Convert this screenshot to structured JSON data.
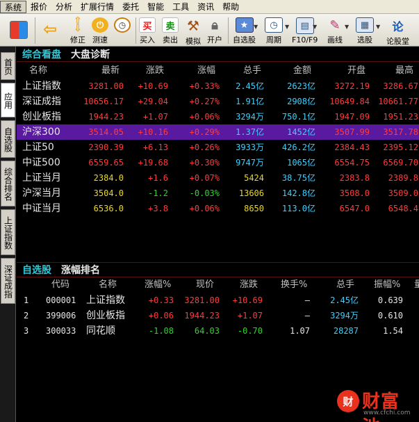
{
  "menu": [
    "系统",
    "报价",
    "分析",
    "扩展行情",
    "委托",
    "智能",
    "工具",
    "资讯",
    "帮助"
  ],
  "toolbar": {
    "modify": "修正",
    "speed": "测速",
    "buy": "买入",
    "sell": "卖出",
    "simulate": "模拟",
    "open_account": "开户",
    "watchlist": "自选股",
    "period": "周期",
    "f10": "F10/F9",
    "draw": "画线",
    "select_stock": "选股",
    "forum": "论股堂",
    "buy_icon": "买",
    "sell_icon": "卖"
  },
  "sidetabs": [
    "首页",
    "应用",
    "自选股",
    "综合排名",
    "上证指数",
    "深证成指"
  ],
  "panel1": {
    "title": "综合看盘",
    "subtitle": "大盘诊断",
    "headers": [
      "名称",
      "最新",
      "涨跌",
      "涨幅",
      "总手",
      "金额",
      "开盘",
      "最高"
    ],
    "rows": [
      {
        "name": "上证指数",
        "last": "3281.00",
        "chg": "+10.69",
        "pct": "+0.33%",
        "vol": "2.45亿",
        "amt": "2623亿",
        "open": "3272.19",
        "high": "3286.67"
      },
      {
        "name": "深证成指",
        "last": "10656.17",
        "chg": "+29.04",
        "pct": "+0.27%",
        "vol": "1.91亿",
        "amt": "2908亿",
        "open": "10649.84",
        "high": "10661.77"
      },
      {
        "name": "创业板指",
        "last": "1944.23",
        "chg": "+1.07",
        "pct": "+0.06%",
        "vol": "3294万",
        "amt": "750.1亿",
        "open": "1947.09",
        "high": "1951.23"
      },
      {
        "name": "沪深300",
        "last": "3514.05",
        "chg": "+10.16",
        "pct": "+0.29%",
        "vol": "1.37亿",
        "amt": "1452亿",
        "open": "3507.99",
        "high": "3517.78"
      },
      {
        "name": "上证50",
        "last": "2390.39",
        "chg": "+6.13",
        "pct": "+0.26%",
        "vol": "3933万",
        "amt": "426.2亿",
        "open": "2384.43",
        "high": "2395.12"
      },
      {
        "name": "中证500",
        "last": "6559.65",
        "chg": "+19.68",
        "pct": "+0.30%",
        "vol": "9747万",
        "amt": "1065亿",
        "open": "6554.75",
        "high": "6569.70"
      },
      {
        "name": "上证当月",
        "last": "2384.0",
        "chg": "+1.6",
        "pct": "+0.07%",
        "vol": "5424",
        "amt": "38.75亿",
        "open": "2383.8",
        "high": "2389.8"
      },
      {
        "name": "沪深当月",
        "last": "3504.0",
        "chg": "-1.2",
        "pct": "-0.03%",
        "vol": "13606",
        "amt": "142.8亿",
        "open": "3508.0",
        "high": "3509.0"
      },
      {
        "name": "中证当月",
        "last": "6536.0",
        "chg": "+3.8",
        "pct": "+0.06%",
        "vol": "8650",
        "amt": "113.0亿",
        "open": "6547.0",
        "high": "6548.4"
      }
    ]
  },
  "panel2": {
    "title": "自选股",
    "subtitle": "涨幅排名",
    "headers": [
      "代码",
      "名称",
      "涨幅%",
      "现价",
      "涨跌",
      "换手%",
      "总手",
      "振幅%",
      "量"
    ],
    "rows": [
      {
        "idx": "1",
        "code": "000001",
        "name": "上证指数",
        "pct": "+0.33",
        "price": "3281.00",
        "chg": "+10.69",
        "turnover": "—",
        "vol": "2.45亿",
        "amp": "0.639"
      },
      {
        "idx": "2",
        "code": "399006",
        "name": "创业板指",
        "pct": "+0.06",
        "price": "1944.23",
        "chg": "+1.07",
        "turnover": "—",
        "vol": "3294万",
        "amp": "0.610"
      },
      {
        "idx": "3",
        "code": "300033",
        "name": "同花顺",
        "pct": "-1.08",
        "price": "64.03",
        "chg": "-0.70",
        "turnover": "1.07",
        "vol": "28287",
        "amp": "1.54"
      }
    ]
  },
  "watermark": {
    "text": "财富池",
    "badge": "财",
    "url": "www.cfchi.com"
  },
  "colors": {
    "up": "#ff3b3b",
    "down": "#2fd42f",
    "accent": "#30c8d8",
    "selected_row": "#5a1aa0"
  }
}
